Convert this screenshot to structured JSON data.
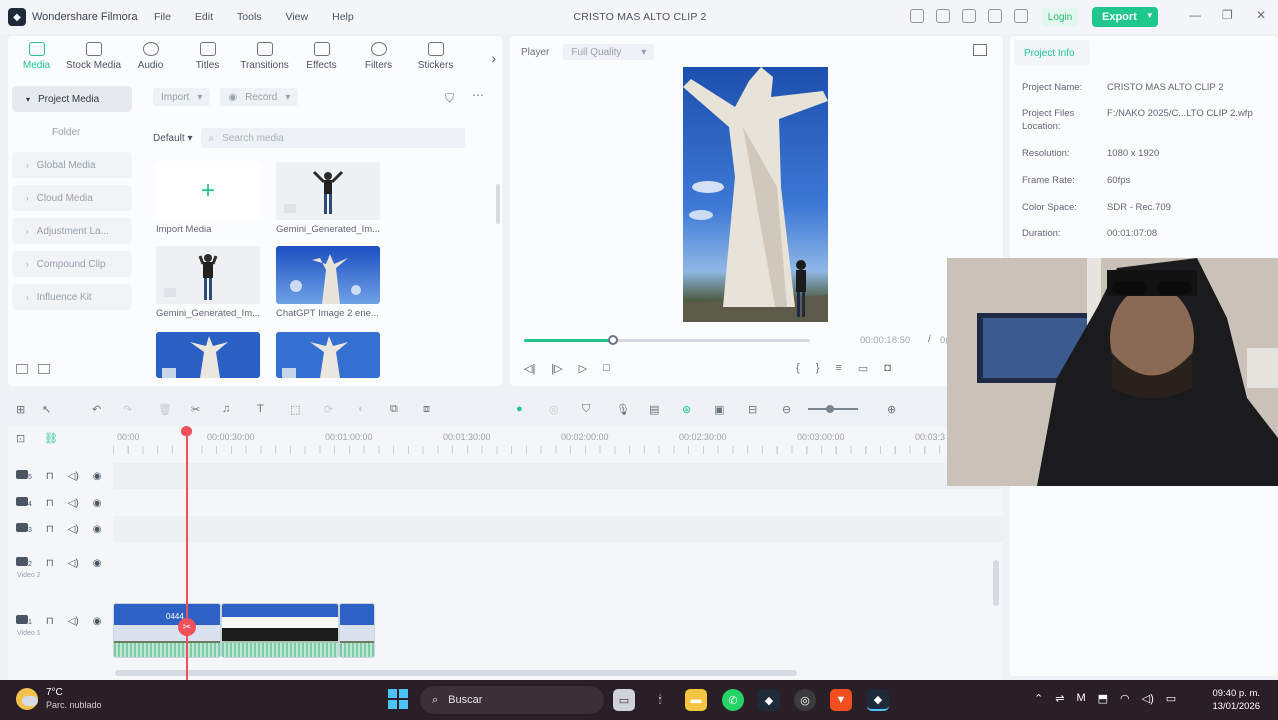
{
  "app": {
    "name": "Wondershare Filmora",
    "project_title": "CRISTO MAS ALTO CLIP 2"
  },
  "menu": [
    "File",
    "Edit",
    "Tools",
    "View",
    "Help"
  ],
  "header": {
    "login_label": "Login",
    "export_label": "Export"
  },
  "media_tabs": [
    {
      "label": "Media",
      "icon": "media-icon",
      "active": true
    },
    {
      "label": "Stock Media",
      "icon": "stock-media-icon"
    },
    {
      "label": "Audio",
      "icon": "music-note-icon"
    },
    {
      "label": "Titles",
      "icon": "text-t-icon"
    },
    {
      "label": "Transitions",
      "icon": "transition-icon"
    },
    {
      "label": "Effects",
      "icon": "effects-icon"
    },
    {
      "label": "Filters",
      "icon": "filters-icon"
    },
    {
      "label": "Stickers",
      "icon": "stickers-icon"
    }
  ],
  "sidebar": {
    "items": [
      "Project Media",
      "Folder",
      "Global Media",
      "Cloud Media",
      "Adjustment La...",
      "Compound Clip",
      "Influence Kit"
    ]
  },
  "media_toolbar": {
    "import_label": "Import",
    "record_label": "Record",
    "sort_label": "Default",
    "search_placeholder": "Search media"
  },
  "media_items": [
    {
      "caption": "Import Media"
    },
    {
      "caption": "Gemini_Generated_Im..."
    },
    {
      "caption": "Gemini_Generated_Im..."
    },
    {
      "caption": "ChatGPT Image 2 ene..."
    },
    {
      "caption": ""
    },
    {
      "caption": ""
    }
  ],
  "player": {
    "label": "Player",
    "quality": "Full Quality",
    "current_time": "00:00:18:50",
    "total_time_partial": "0(",
    "progress": 0.31
  },
  "project_info": {
    "tab_label": "Project Info",
    "rows": [
      {
        "key": "Project Name:",
        "value": "CRISTO MAS ALTO CLIP 2"
      },
      {
        "key": "Project Files Location:",
        "value": "F:/NAKO 2025/C...LTO CLIP 2.wfp"
      },
      {
        "key": "Resolution:",
        "value": "1080 x 1920"
      },
      {
        "key": "Frame Rate:",
        "value": "60fps"
      },
      {
        "key": "Color Space:",
        "value": "SDR - Rec.709"
      },
      {
        "key": "Duration:",
        "value": "00:01:07:08"
      }
    ]
  },
  "timeline": {
    "ruler_labels": [
      "00:00",
      "00:00:30:00",
      "00:01:00:00",
      "00:01:30:00",
      "00:02:00:00",
      "00:02:30:00",
      "00:03:00:00",
      "00:03:3"
    ],
    "tracks": [
      {
        "num": "5",
        "label": ""
      },
      {
        "num": "4",
        "label": ""
      },
      {
        "num": "3",
        "label": ""
      },
      {
        "num": "2",
        "label": "Video 2"
      },
      {
        "num": "1",
        "label": "Video 1"
      }
    ],
    "clip_label": "0444"
  },
  "taskbar": {
    "weather_temp": "7°C",
    "weather_desc": "Parc. nublado",
    "search_placeholder": "Buscar",
    "time": "09:40 p. m.",
    "date": "13/01/2026"
  },
  "colors": {
    "accent": "#1fc78d",
    "playhead": "#f0505a",
    "taskbar": "#2a1f26"
  }
}
